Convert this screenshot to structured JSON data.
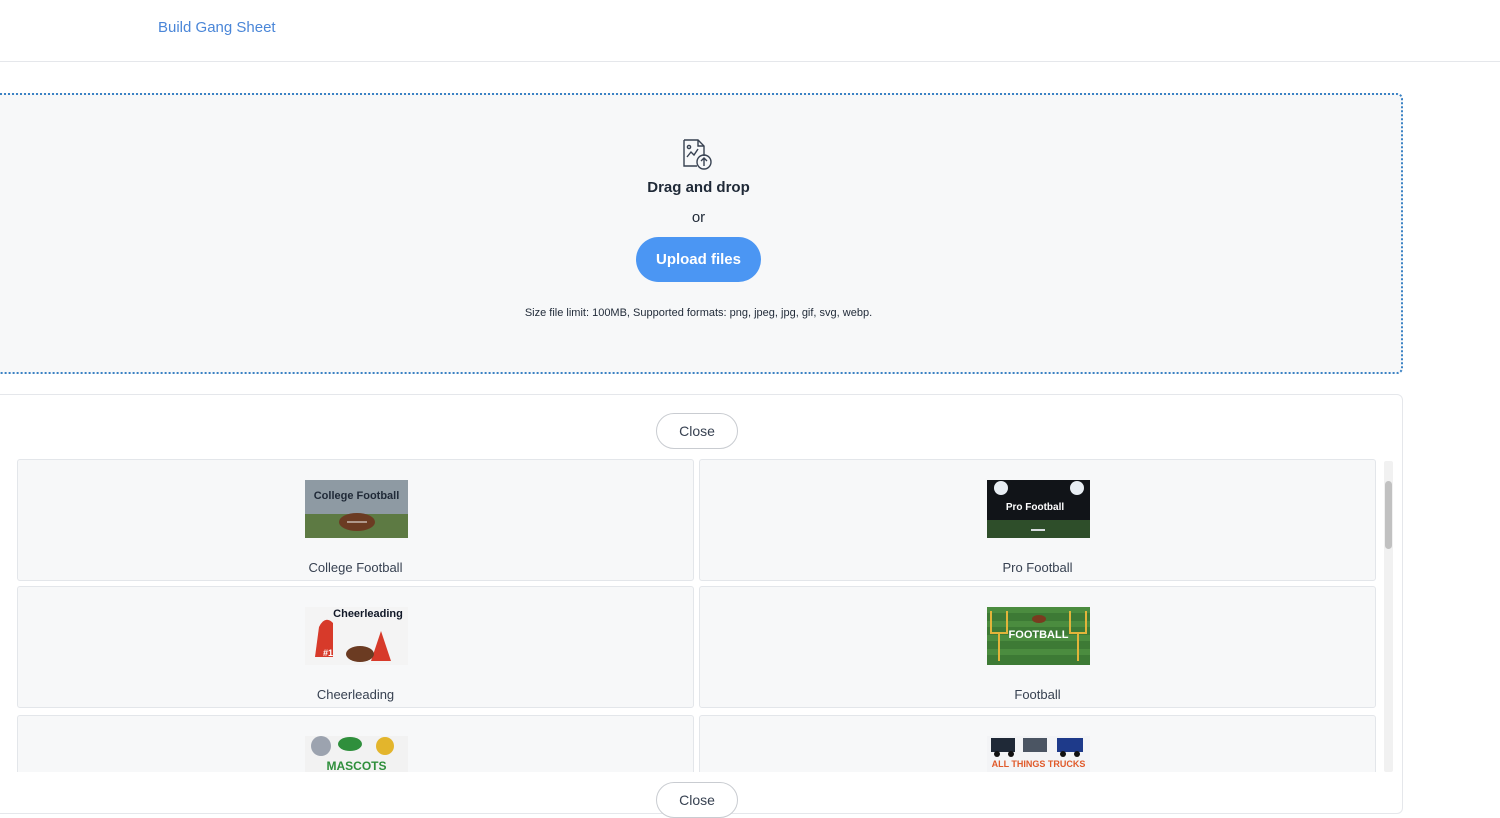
{
  "nav": {
    "build_link": "Build Gang Sheet"
  },
  "upload": {
    "icon": "file-upload-icon",
    "title": "Drag and drop",
    "or_text": "or",
    "button_label": "Upload files",
    "note": "Size file limit: 100MB, Supported formats: png, jpeg, jpg, gif, svg, webp."
  },
  "panel": {
    "close_label": "Close",
    "close_label_bottom": "Close",
    "items": [
      {
        "label": "College Football",
        "thumb_text": "College Football"
      },
      {
        "label": "Pro Football",
        "thumb_text": "Pro Football"
      },
      {
        "label": "Cheerleading",
        "thumb_text": "Cheerleading"
      },
      {
        "label": "Football",
        "thumb_text": "FOOTBALL"
      },
      {
        "label": "",
        "thumb_text": "MASCOTS"
      },
      {
        "label": "",
        "thumb_text": "ALL THINGS TRUCKS"
      }
    ]
  },
  "colors": {
    "accent": "#4b96f3",
    "link": "#4a86d8",
    "dropzone_border": "#3b82c4"
  }
}
